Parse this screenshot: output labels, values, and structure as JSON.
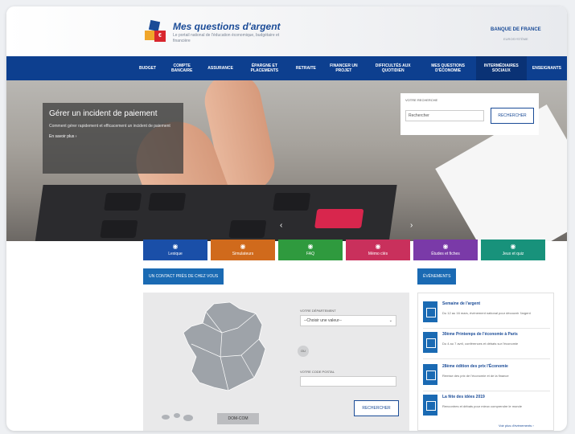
{
  "header": {
    "site_title": "Mes questions d'argent",
    "site_subtitle": "Le portail national de l'éducation économique, budgétaire et financière",
    "partner": "BANQUE DE FRANCE",
    "partner_sub": "EUROSYSTÈME"
  },
  "nav": {
    "items": [
      {
        "label": "BUDGET"
      },
      {
        "label": "COMPTE BANCAIRE"
      },
      {
        "label": "ASSURANCE"
      },
      {
        "label": "ÉPARGNE ET PLACEMENTS"
      },
      {
        "label": "RETRAITE"
      },
      {
        "label": "FINANCER UN PROJET"
      },
      {
        "label": "DIFFICULTÉS AUX QUOTIDIEN"
      },
      {
        "label": "MES QUESTIONS D'ÉCONOMIE"
      },
      {
        "label": "INTERMÉDIAIRES SOCIAUX"
      },
      {
        "label": "ENSEIGNANTS"
      }
    ]
  },
  "hero": {
    "title": "Gérer un incident de paiement",
    "text": "Comment gérer rapidement et efficacement un incident de paiement",
    "more": "En savoir plus"
  },
  "search": {
    "label": "VOTRE RECHERCHE",
    "placeholder": "Rechercher",
    "button": "RECHERCHER"
  },
  "tiles": [
    {
      "label": "Lexique",
      "icon": "book-icon",
      "color": "#1a4fa8"
    },
    {
      "label": "Simulateurs",
      "icon": "calculator-icon",
      "color": "#d06a1c"
    },
    {
      "label": "FAQ",
      "icon": "question-icon",
      "color": "#2f9a3e"
    },
    {
      "label": "Mémo clés",
      "icon": "key-icon",
      "color": "#c9305c"
    },
    {
      "label": "Études et fiches",
      "icon": "document-icon",
      "color": "#7a3aa8"
    },
    {
      "label": "Jeux et quiz",
      "icon": "puzzle-icon",
      "color": "#18927b"
    }
  ],
  "contact": {
    "title": "UN CONTACT PRÈS DE CHEZ VOUS",
    "dept_label": "VOTRE DÉPARTEMENT",
    "dept_value": "--Choisir une valeur--",
    "or": "OU",
    "cp_label": "VOTRE CODE POSTAL",
    "button": "RECHERCHER",
    "dom_button": "DOM-COM"
  },
  "events": {
    "title": "ÉVÉNEMENTS",
    "items": [
      {
        "title": "Semaine de l'argent",
        "desc": "Du 12 au 16 mars, événement national pour découvrir l'argent"
      },
      {
        "title": "30ème Printemps de l'économie à Paris",
        "desc": "Du 4 au 7 avril, conférences et débats sur l'économie"
      },
      {
        "title": "28ème édition des prix l'Économie",
        "desc": "Remise des prix de l'économie et de la finance"
      },
      {
        "title": "La fête des idées 2019",
        "desc": "Rencontres et débats pour mieux comprendre le monde"
      }
    ],
    "more": "Voir plus d'événements"
  },
  "colors": {
    "nav": "#0d3f8f",
    "accent": "#1a6ab3"
  }
}
